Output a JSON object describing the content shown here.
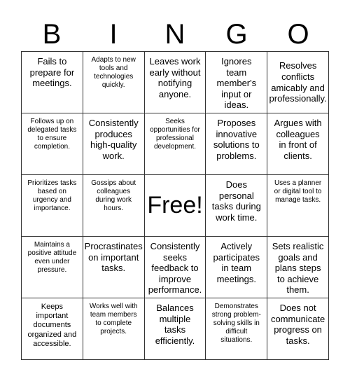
{
  "header": [
    "B",
    "I",
    "N",
    "G",
    "O"
  ],
  "cells": [
    [
      "Fails to prepare for meetings.",
      "Adapts to new tools and technologies quickly.",
      "Leaves work early without notifying anyone.",
      "Ignores team member's input or ideas.",
      "Resolves conflicts amicably and professionally."
    ],
    [
      "Follows up on delegated tasks to ensure completion.",
      "Consistently produces high-quality work.",
      "Seeks opportunities for professional development.",
      "Proposes innovative solutions to problems.",
      "Argues with colleagues in front of clients."
    ],
    [
      "Prioritizes tasks based on urgency and importance.",
      "Gossips about colleagues during work hours.",
      "Free!",
      "Does personal tasks during work time.",
      "Uses a planner or digital tool to manage tasks."
    ],
    [
      "Maintains a positive attitude even under pressure.",
      "Procrastinates on important tasks.",
      "Consistently seeks feedback to improve performance.",
      "Actively participates in team meetings.",
      "Sets realistic goals and plans steps to achieve them."
    ],
    [
      "Keeps important documents organized and accessible.",
      "Works well with team members to complete projects.",
      "Balances multiple tasks efficiently.",
      "Demonstrates strong problem-solving skills in difficult situations.",
      "Does not communicate progress on tasks."
    ]
  ]
}
